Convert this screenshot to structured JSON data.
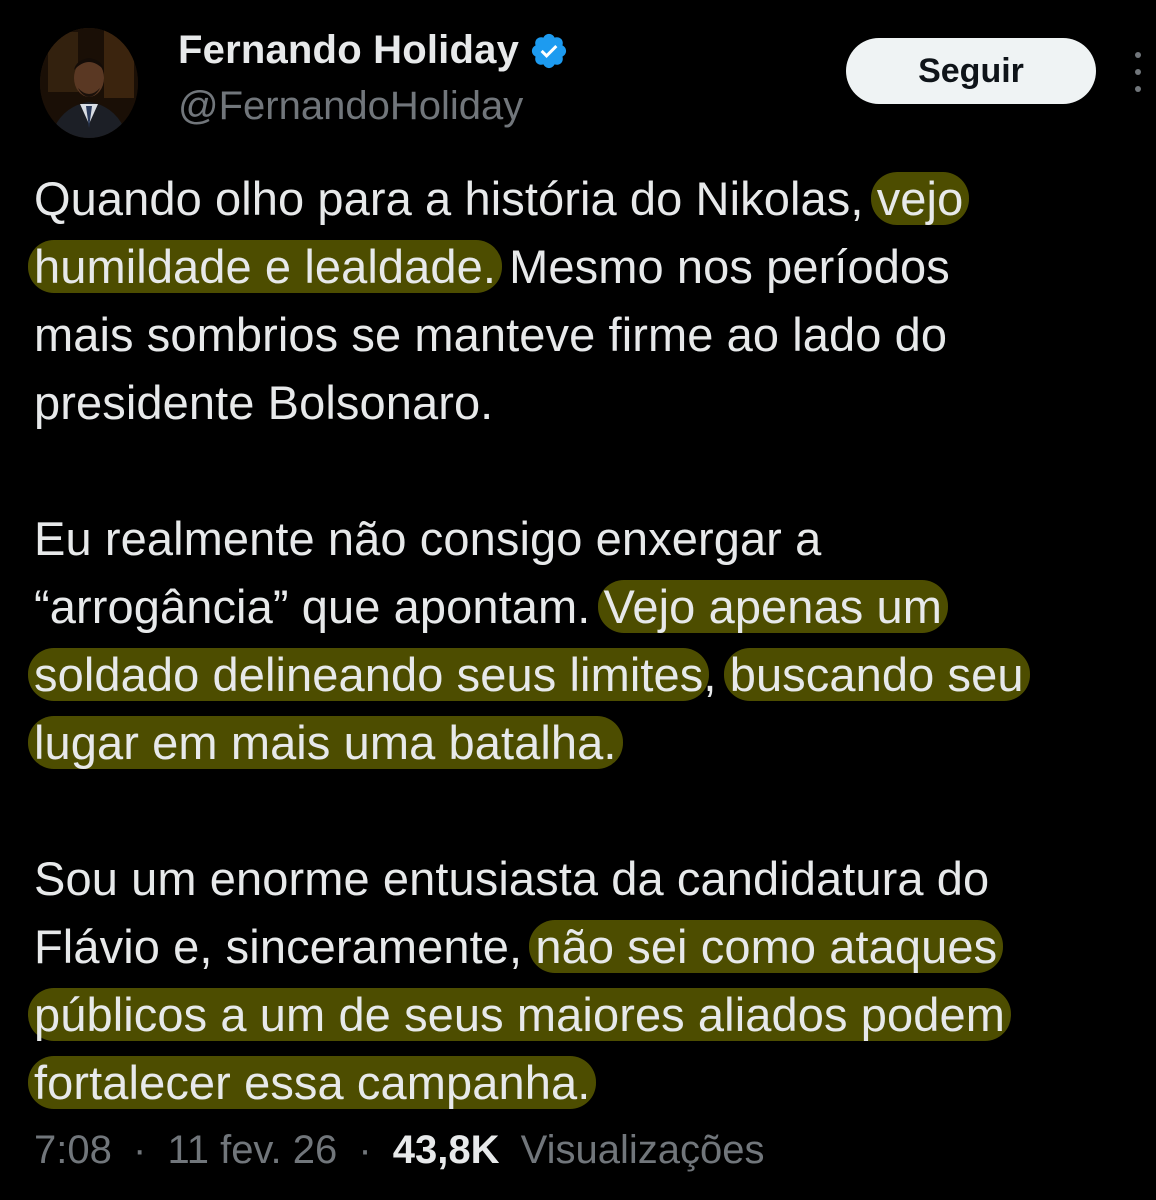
{
  "author": {
    "name": "Fernando Holiday",
    "handle": "@FernandoHoliday",
    "verified": true
  },
  "follow_button": {
    "label": "Seguir"
  },
  "tweet": {
    "lines": [
      {
        "segments": [
          {
            "text": "Quando olho para a história do Nikolas, ",
            "highlight": false
          },
          {
            "text": "vejo",
            "highlight": true
          }
        ]
      },
      {
        "segments": [
          {
            "text": "humildade e lealdade.",
            "highlight": true
          },
          {
            "text": " Mesmo nos períodos",
            "highlight": false
          }
        ]
      },
      {
        "segments": [
          {
            "text": "mais sombrios se manteve firme ao lado do",
            "highlight": false
          }
        ]
      },
      {
        "segments": [
          {
            "text": "presidente Bolsonaro.",
            "highlight": false
          }
        ]
      },
      {
        "gap": true
      },
      {
        "segments": [
          {
            "text": "Eu realmente não consigo enxergar a",
            "highlight": false
          }
        ]
      },
      {
        "segments": [
          {
            "text": "“arrogância” que apontam. ",
            "highlight": false
          },
          {
            "text": "Vejo apenas um",
            "highlight": true
          }
        ]
      },
      {
        "segments": [
          {
            "text": "soldado delineando seus limites",
            "highlight": true
          },
          {
            "text": ", ",
            "highlight": false
          },
          {
            "text": "buscando seu",
            "highlight": true
          }
        ]
      },
      {
        "segments": [
          {
            "text": "lugar em mais uma batalha.",
            "highlight": true
          }
        ]
      },
      {
        "gap": true
      },
      {
        "segments": [
          {
            "text": "Sou um enorme entusiasta da candidatura do",
            "highlight": false
          }
        ]
      },
      {
        "segments": [
          {
            "text": "Flávio e, sinceramente, ",
            "highlight": false
          },
          {
            "text": "não sei como ataques",
            "highlight": true
          }
        ]
      },
      {
        "segments": [
          {
            "text": "públicos a um de seus maiores aliados podem",
            "highlight": true
          }
        ]
      },
      {
        "segments": [
          {
            "text": "fortalecer essa campanha.",
            "highlight": true
          }
        ]
      }
    ],
    "highlight_color": "#6b6b00"
  },
  "meta": {
    "time": "7:08",
    "date": "11 fev. 26",
    "separator": "·",
    "views_count": "43,8K",
    "views_label": "Visualizações"
  },
  "colors": {
    "background": "#000000",
    "text": "#e7e9ea",
    "secondary": "#71767b",
    "verified": "#1d9bf0"
  },
  "icons": [
    "verified-badge-icon",
    "more-options-icon"
  ]
}
